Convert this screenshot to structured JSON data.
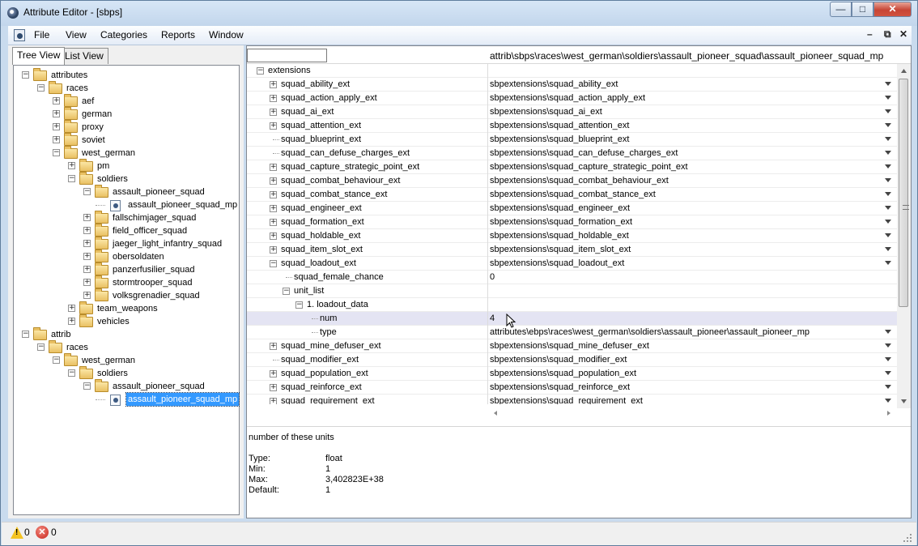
{
  "window": {
    "title": "Attribute Editor - [sbps]"
  },
  "menu": [
    "File",
    "View",
    "Categories",
    "Reports",
    "Window"
  ],
  "tabs": {
    "tree_view": "Tree View",
    "list_view": "List View"
  },
  "tree": [
    {
      "label": "attributes",
      "depth": 0,
      "exp": "-",
      "icon": "folder"
    },
    {
      "label": "races",
      "depth": 1,
      "exp": "-",
      "icon": "folder"
    },
    {
      "label": "aef",
      "depth": 2,
      "exp": "+",
      "icon": "folder"
    },
    {
      "label": "german",
      "depth": 2,
      "exp": "+",
      "icon": "folder"
    },
    {
      "label": "proxy",
      "depth": 2,
      "exp": "+",
      "icon": "folder"
    },
    {
      "label": "soviet",
      "depth": 2,
      "exp": "+",
      "icon": "folder"
    },
    {
      "label": "west_german",
      "depth": 2,
      "exp": "-",
      "icon": "folder"
    },
    {
      "label": "pm",
      "depth": 3,
      "exp": "+",
      "icon": "folder"
    },
    {
      "label": "soldiers",
      "depth": 3,
      "exp": "-",
      "icon": "folder"
    },
    {
      "label": "assault_pioneer_squad",
      "depth": 4,
      "exp": "-",
      "icon": "folder"
    },
    {
      "label": "assault_pioneer_squad_mp",
      "depth": 5,
      "exp": "",
      "icon": "file"
    },
    {
      "label": "fallschimjager_squad",
      "depth": 4,
      "exp": "+",
      "icon": "folder"
    },
    {
      "label": "field_officer_squad",
      "depth": 4,
      "exp": "+",
      "icon": "folder"
    },
    {
      "label": "jaeger_light_infantry_squad",
      "depth": 4,
      "exp": "+",
      "icon": "folder"
    },
    {
      "label": "obersoldaten",
      "depth": 4,
      "exp": "+",
      "icon": "folder"
    },
    {
      "label": "panzerfusilier_squad",
      "depth": 4,
      "exp": "+",
      "icon": "folder"
    },
    {
      "label": "stormtrooper_squad",
      "depth": 4,
      "exp": "+",
      "icon": "folder"
    },
    {
      "label": "volksgrenadier_squad",
      "depth": 4,
      "exp": "+",
      "icon": "folder"
    },
    {
      "label": "team_weapons",
      "depth": 3,
      "exp": "+",
      "icon": "folder"
    },
    {
      "label": "vehicles",
      "depth": 3,
      "exp": "+",
      "icon": "folder"
    },
    {
      "label": "attrib",
      "depth": 0,
      "exp": "-",
      "icon": "folder"
    },
    {
      "label": "races",
      "depth": 1,
      "exp": "-",
      "icon": "folder"
    },
    {
      "label": "west_german",
      "depth": 2,
      "exp": "-",
      "icon": "folder"
    },
    {
      "label": "soldiers",
      "depth": 3,
      "exp": "-",
      "icon": "folder"
    },
    {
      "label": "assault_pioneer_squad",
      "depth": 4,
      "exp": "-",
      "icon": "folder"
    },
    {
      "label": "assault_pioneer_squad_mp",
      "depth": 5,
      "exp": "",
      "icon": "file",
      "selected": true
    }
  ],
  "grid": {
    "path": "attrib\\sbps\\races\\west_german\\soldiers\\assault_pioneer_squad\\assault_pioneer_squad_mp",
    "rows": [
      {
        "name": "extensions",
        "value": "",
        "depth": 0,
        "exp": "-",
        "drop": false
      },
      {
        "name": "squad_ability_ext",
        "value": "sbpextensions\\squad_ability_ext",
        "depth": 1,
        "exp": "+",
        "drop": true
      },
      {
        "name": "squad_action_apply_ext",
        "value": "sbpextensions\\squad_action_apply_ext",
        "depth": 1,
        "exp": "+",
        "drop": true
      },
      {
        "name": "squad_ai_ext",
        "value": "sbpextensions\\squad_ai_ext",
        "depth": 1,
        "exp": "+",
        "drop": true
      },
      {
        "name": "squad_attention_ext",
        "value": "sbpextensions\\squad_attention_ext",
        "depth": 1,
        "exp": "+",
        "drop": true
      },
      {
        "name": "squad_blueprint_ext",
        "value": "sbpextensions\\squad_blueprint_ext",
        "depth": 1,
        "exp": "",
        "drop": true
      },
      {
        "name": "squad_can_defuse_charges_ext",
        "value": "sbpextensions\\squad_can_defuse_charges_ext",
        "depth": 1,
        "exp": "",
        "drop": true
      },
      {
        "name": "squad_capture_strategic_point_ext",
        "value": "sbpextensions\\squad_capture_strategic_point_ext",
        "depth": 1,
        "exp": "+",
        "drop": true
      },
      {
        "name": "squad_combat_behaviour_ext",
        "value": "sbpextensions\\squad_combat_behaviour_ext",
        "depth": 1,
        "exp": "+",
        "drop": true
      },
      {
        "name": "squad_combat_stance_ext",
        "value": "sbpextensions\\squad_combat_stance_ext",
        "depth": 1,
        "exp": "+",
        "drop": true
      },
      {
        "name": "squad_engineer_ext",
        "value": "sbpextensions\\squad_engineer_ext",
        "depth": 1,
        "exp": "+",
        "drop": true
      },
      {
        "name": "squad_formation_ext",
        "value": "sbpextensions\\squad_formation_ext",
        "depth": 1,
        "exp": "+",
        "drop": true
      },
      {
        "name": "squad_holdable_ext",
        "value": "sbpextensions\\squad_holdable_ext",
        "depth": 1,
        "exp": "+",
        "drop": true
      },
      {
        "name": "squad_item_slot_ext",
        "value": "sbpextensions\\squad_item_slot_ext",
        "depth": 1,
        "exp": "+",
        "drop": true
      },
      {
        "name": "squad_loadout_ext",
        "value": "sbpextensions\\squad_loadout_ext",
        "depth": 1,
        "exp": "-",
        "drop": true
      },
      {
        "name": "squad_female_chance",
        "value": "0",
        "depth": 2,
        "exp": "",
        "drop": false
      },
      {
        "name": "unit_list",
        "value": "",
        "depth": 2,
        "exp": "-",
        "drop": false
      },
      {
        "name": "1. loadout_data",
        "value": "",
        "depth": 3,
        "exp": "-",
        "drop": false
      },
      {
        "name": "num",
        "value": "4",
        "depth": 4,
        "exp": "",
        "drop": false,
        "highlight": true
      },
      {
        "name": "type",
        "value": "attributes\\ebps\\races\\west_german\\soldiers\\assault_pioneer\\assault_pioneer_mp",
        "depth": 4,
        "exp": "",
        "drop": true
      },
      {
        "name": "squad_mine_defuser_ext",
        "value": "sbpextensions\\squad_mine_defuser_ext",
        "depth": 1,
        "exp": "+",
        "drop": true
      },
      {
        "name": "squad_modifier_ext",
        "value": "sbpextensions\\squad_modifier_ext",
        "depth": 1,
        "exp": "",
        "drop": true
      },
      {
        "name": "squad_population_ext",
        "value": "sbpextensions\\squad_population_ext",
        "depth": 1,
        "exp": "+",
        "drop": true
      },
      {
        "name": "squad_reinforce_ext",
        "value": "sbpextensions\\squad_reinforce_ext",
        "depth": 1,
        "exp": "+",
        "drop": true
      },
      {
        "name": "squad_requirement_ext",
        "value": "sbpextensions\\squad_requirement_ext",
        "depth": 1,
        "exp": "+",
        "drop": true
      }
    ]
  },
  "description": {
    "text": "number of these units",
    "type_label": "Type:",
    "type_value": "float",
    "min_label": "Min:",
    "min_value": "1",
    "max_label": "Max:",
    "max_value": "3,402823E+38",
    "default_label": "Default:",
    "default_value": "1"
  },
  "status": {
    "warnings": "0",
    "errors": "0"
  }
}
